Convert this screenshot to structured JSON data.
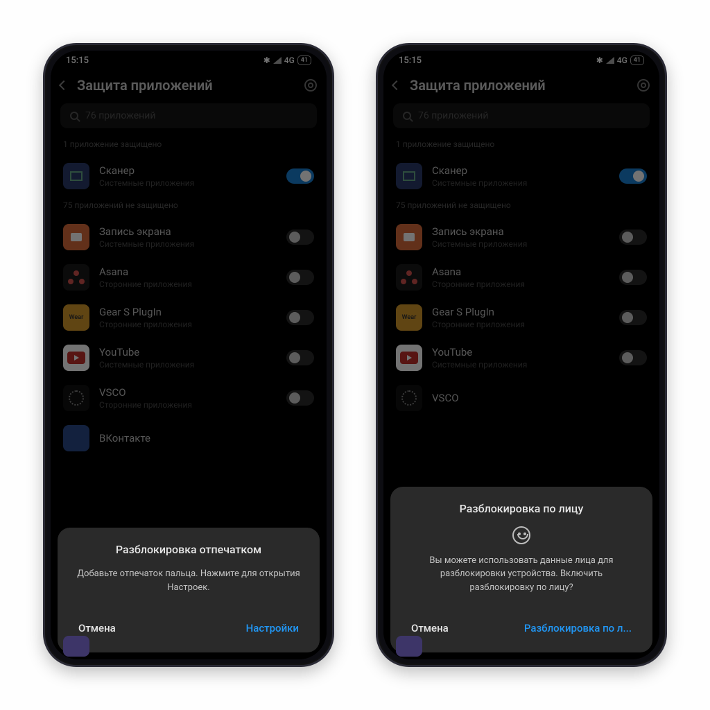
{
  "status": {
    "time": "15:15",
    "network": "4G",
    "battery": "41"
  },
  "header": {
    "title": "Защита приложений"
  },
  "search": {
    "placeholder": "76 приложений"
  },
  "sections": {
    "protected_label": "1 приложение защищено",
    "unprotected_label": "75 приложений не защищено"
  },
  "apps": {
    "scanner": {
      "name": "Сканер",
      "sub": "Системные приложения"
    },
    "screenrec": {
      "name": "Запись экрана",
      "sub": "Системные приложения"
    },
    "asana": {
      "name": "Asana",
      "sub": "Сторонние приложения"
    },
    "gears": {
      "name": "Gear S PlugIn",
      "sub": "Сторонние приложения"
    },
    "youtube": {
      "name": "YouTube",
      "sub": "Системные приложения"
    },
    "vsco": {
      "name": "VSCO",
      "sub": "Сторонние приложения"
    },
    "vk": {
      "name": "ВКонтакте"
    }
  },
  "dialog_fp": {
    "title": "Разблокировка отпечатком",
    "body": "Добавьте отпечаток пальца. Нажмите для открытия Настроек.",
    "cancel": "Отмена",
    "confirm": "Настройки"
  },
  "dialog_face": {
    "title": "Разблокировка по лицу",
    "body": "Вы можете использовать данные лица для разблокировки устройства. Включить разблокировку по лицу?",
    "cancel": "Отмена",
    "confirm": "Разблокировка по л..."
  }
}
